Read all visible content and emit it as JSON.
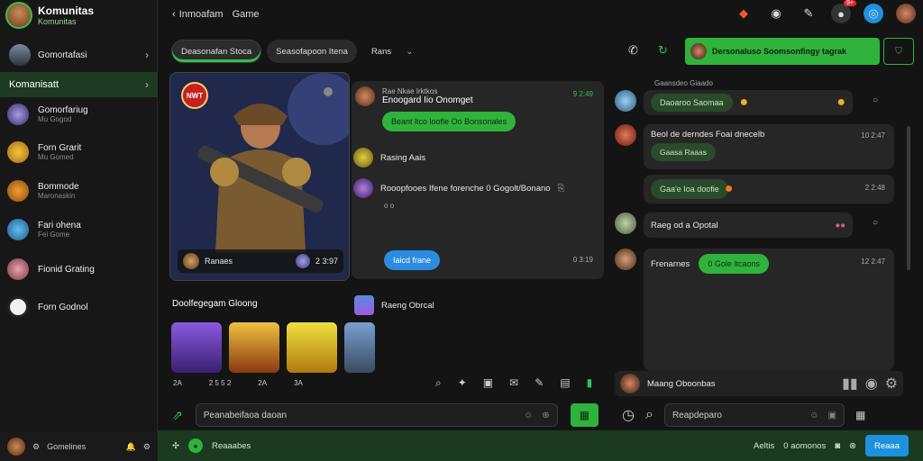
{
  "app": {
    "title": "Komunitas",
    "subtitle": "Komunitas"
  },
  "topbar": {
    "title": "Inmoafam",
    "subtitle": "Game",
    "badge": "9+"
  },
  "sidebar": {
    "header": "Gomortafasi",
    "section": "Komanisatt",
    "items": [
      {
        "name": "Gomorfariug",
        "sub": "Mu Gogod"
      },
      {
        "name": "Forn Grarit",
        "sub": "Mu Gomed"
      },
      {
        "name": "Bommode",
        "sub": "Maronaskin"
      },
      {
        "name": "Fari ohena",
        "sub": "Fei Gome"
      },
      {
        "name": "Fionid Grating",
        "sub": ""
      },
      {
        "name": "Forn Godnol",
        "sub": ""
      }
    ],
    "footer": "Gomelines"
  },
  "tabs": [
    {
      "label": "Deasonafan Stoca"
    },
    {
      "label": "Seasofapoon Itena"
    },
    {
      "label": "Rans"
    }
  ],
  "call": {
    "label": "Dersonaluso Soomsonfingy tagrak"
  },
  "card": {
    "badge": "NWT",
    "name": "Ranaes",
    "time": "2 3:97"
  },
  "chat": {
    "sender": "Rae Nkae Irktkos",
    "title": "Enoogard Iio Onomget",
    "time": "9 2:49",
    "msg1": "Beant ltco loofle Oo Bonsonales",
    "sender2": "Rasing Aais",
    "msg2": "Rooopfooes Ifene forenche 0 Gogolt/Bonano",
    "ack": "o o",
    "msg3": "Iaicd frane",
    "time3": "0 3:19"
  },
  "section2": {
    "title": "Doolfegegam Gloong",
    "name": "Raeng Obrcal",
    "timestamps": [
      "2A",
      "2 5 5 2",
      "2A",
      "3A"
    ]
  },
  "right": {
    "header": "Gaansdeo Giaado",
    "messages": [
      {
        "text": "Daoaroo Saomaa",
        "time": ""
      },
      {
        "text": "Beol de derndes Foai dnecelb",
        "bubble": "Gaasa Raaas",
        "time": "10 2:47"
      },
      {
        "text": "Gaa'e Ioa doofie",
        "time": "2 2:48"
      },
      {
        "text": "Raeg od a Opotal",
        "time": ""
      },
      {
        "text": "Frenarnes",
        "bubble": "0 Gole ltcaons",
        "time": "12 2:47"
      }
    ],
    "footer": "Maang Oboonbas"
  },
  "composer": {
    "placeholder": "Peanabeifaoa daoan",
    "right_placeholder": "Reapdeparo"
  },
  "bottom": {
    "left": "Reaaabes",
    "mid": "Aeltis",
    "count": "0 aomonos",
    "btn": "Reaaa"
  }
}
